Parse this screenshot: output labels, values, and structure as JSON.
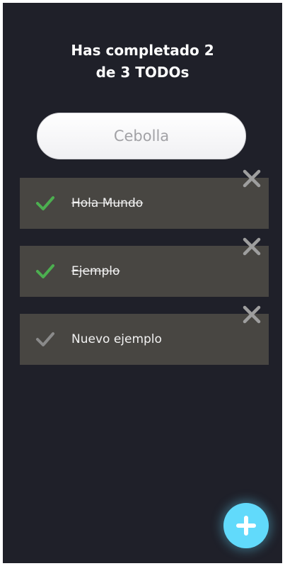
{
  "header": {
    "title_line1": "Has completado 2",
    "title_line2": "de 3 TODOs"
  },
  "search": {
    "placeholder": "Cebolla",
    "value": ""
  },
  "todos": [
    {
      "text": "Hola Mundo",
      "completed": true
    },
    {
      "text": "Ejemplo",
      "completed": true
    },
    {
      "text": "Nuevo ejemplo",
      "completed": false
    }
  ],
  "colors": {
    "background": "#1f2029",
    "todo_card": "#484642",
    "check_done": "#4caf50",
    "check_pending": "#8a8a8a",
    "delete_icon": "#9e9e9e",
    "fab": "#61dafb"
  },
  "icons": {
    "check": "check-icon",
    "delete": "close-icon",
    "add": "plus-icon"
  }
}
